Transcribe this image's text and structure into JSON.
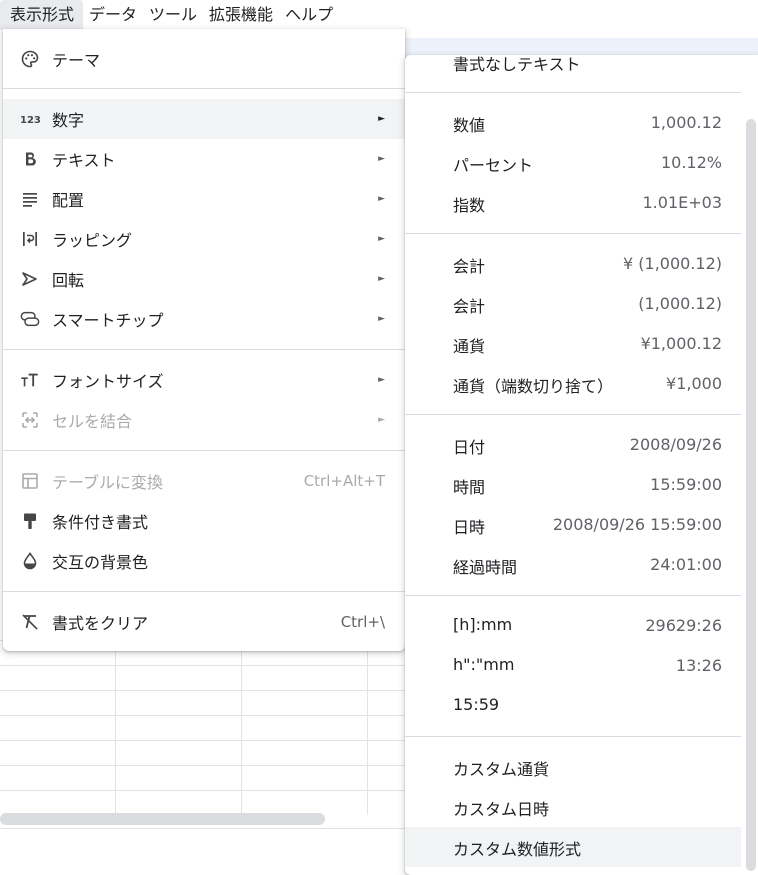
{
  "menubar": {
    "items": [
      "表示形式",
      "データ",
      "ツール",
      "拡張機能",
      "ヘルプ"
    ]
  },
  "format_menu": {
    "items": [
      {
        "label": "テーマ",
        "icon": "palette-icon"
      },
      {
        "label": "数字",
        "icon": "number-123-icon",
        "has_submenu": true,
        "highlighted": true
      },
      {
        "label": "テキスト",
        "icon": "bold-icon",
        "has_submenu": true
      },
      {
        "label": "配置",
        "icon": "align-left-icon",
        "has_submenu": true
      },
      {
        "label": "ラッピング",
        "icon": "text-wrap-icon",
        "has_submenu": true
      },
      {
        "label": "回転",
        "icon": "text-rotate-icon",
        "has_submenu": true
      },
      {
        "label": "スマートチップ",
        "icon": "smart-chip-icon",
        "has_submenu": true
      },
      {
        "label": "フォントサイズ",
        "icon": "font-size-icon",
        "has_submenu": true
      },
      {
        "label": "セルを結合",
        "icon": "merge-cells-icon",
        "has_submenu": true,
        "disabled": true
      },
      {
        "label": "テーブルに変換",
        "icon": "table-icon",
        "shortcut": "Ctrl+Alt+T",
        "disabled": true
      },
      {
        "label": "条件付き書式",
        "icon": "paint-roller-icon"
      },
      {
        "label": "交互の背景色",
        "icon": "fill-drop-icon"
      },
      {
        "label": "書式をクリア",
        "icon": "clear-format-icon",
        "shortcut": "Ctrl+\\"
      }
    ],
    "submenu_arrow": "►"
  },
  "number_submenu": {
    "items": [
      {
        "label": "書式なしテキスト",
        "value": ""
      },
      {
        "label": "数値",
        "value": "1,000.12"
      },
      {
        "label": "パーセント",
        "value": "10.12%"
      },
      {
        "label": "指数",
        "value": "1.01E+03"
      },
      {
        "label": "会計",
        "value": "¥ (1,000.12)"
      },
      {
        "label": "会計",
        "value": "(1,000.12)"
      },
      {
        "label": "通貨",
        "value": "¥1,000.12"
      },
      {
        "label": "通貨（端数切り捨て）",
        "value": "¥1,000"
      },
      {
        "label": "日付",
        "value": "2008/09/26"
      },
      {
        "label": "時間",
        "value": "15:59:00"
      },
      {
        "label": "日時",
        "value": "2008/09/26 15:59:00"
      },
      {
        "label": "経過時間",
        "value": "24:01:00"
      },
      {
        "label": "[h]:mm",
        "value": "29629:26"
      },
      {
        "label": "h\":\"mm",
        "value": "13:26"
      },
      {
        "label": "15:59",
        "value": ""
      },
      {
        "label": "カスタム通貨",
        "value": ""
      },
      {
        "label": "カスタム日時",
        "value": ""
      },
      {
        "label": "カスタム数値形式",
        "value": "",
        "highlighted": true
      }
    ]
  },
  "colors": {
    "highlight": "#f1f3f4",
    "menubar_active": "#e8eaed",
    "divider": "#dadce0",
    "secondary_text": "#5f6368",
    "disabled_text": "#a8abae"
  }
}
